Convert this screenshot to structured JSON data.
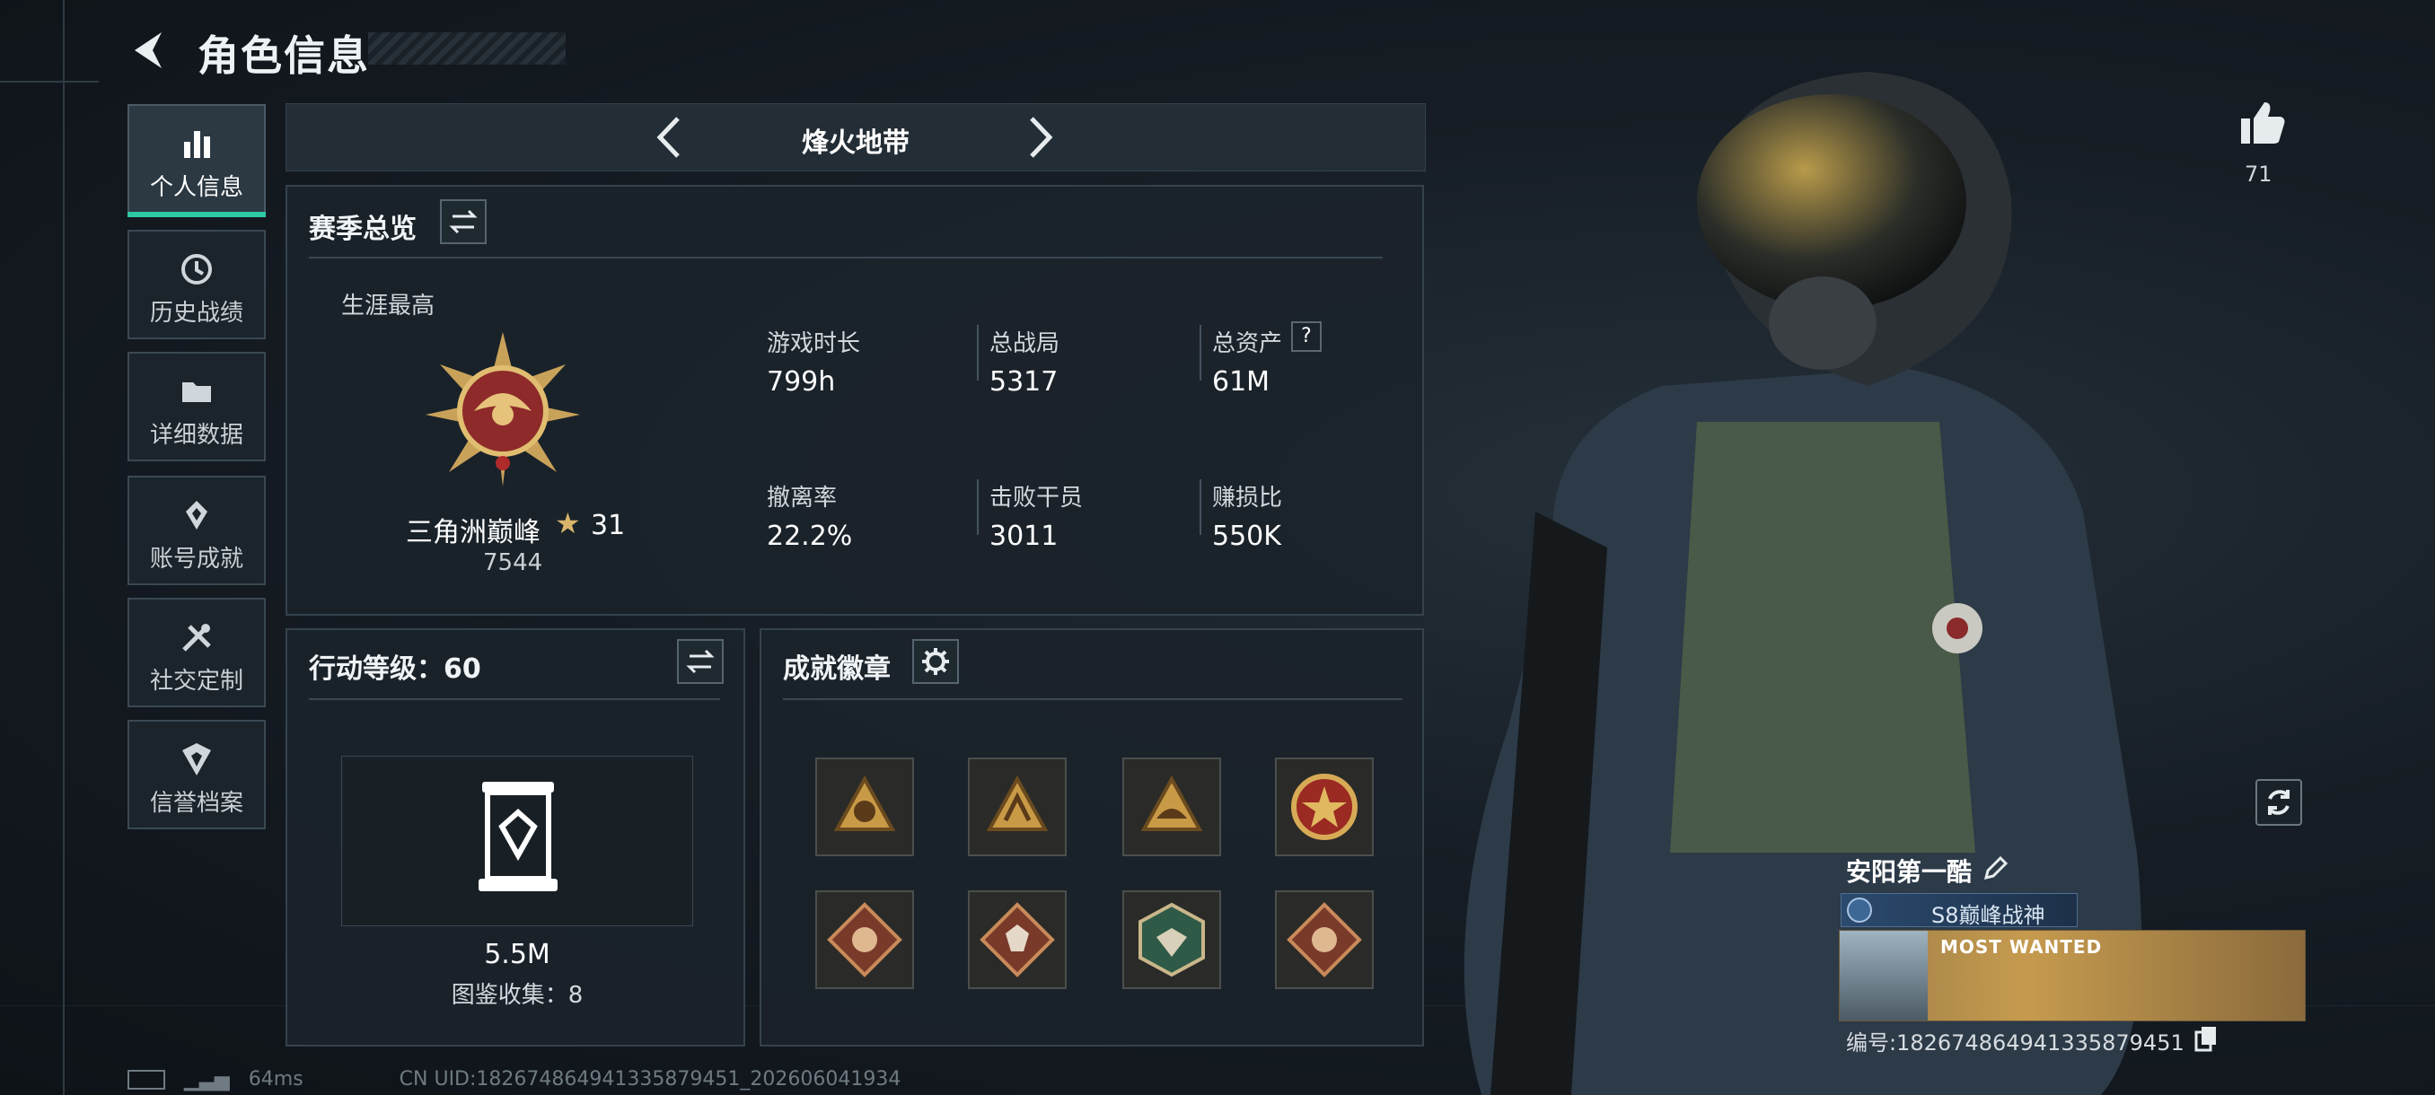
{
  "header": {
    "title": "角色信息"
  },
  "sidebar": {
    "items": [
      {
        "label": "个人信息",
        "icon": "bar-chart-icon",
        "active": true
      },
      {
        "label": "历史战绩",
        "icon": "history-icon"
      },
      {
        "label": "详细数据",
        "icon": "folder-icon"
      },
      {
        "label": "账号成就",
        "icon": "achievement-icon"
      },
      {
        "label": "社交定制",
        "icon": "tools-icon"
      },
      {
        "label": "信誉档案",
        "icon": "shield-icon"
      }
    ]
  },
  "mode": {
    "label": "烽火地带"
  },
  "season": {
    "title": "赛季总览",
    "career_label": "生涯最高",
    "rank_name": "三角洲巅峰",
    "rank_stars": "31",
    "rank_score": "7544",
    "stats": [
      {
        "label": "游戏时长",
        "value": "799h"
      },
      {
        "label": "总战局",
        "value": "5317"
      },
      {
        "label": "总资产",
        "value": "61M",
        "help": "?"
      },
      {
        "label": "撤离率",
        "value": "22.2%"
      },
      {
        "label": "击败干员",
        "value": "3011"
      },
      {
        "label": "赚损比",
        "value": "550K"
      }
    ]
  },
  "action": {
    "title": "行动等级：60",
    "value": "5.5M",
    "collection": "图鉴收集：8"
  },
  "badges": {
    "title": "成就徽章"
  },
  "player": {
    "likes": "71",
    "name": "安阳第一酷",
    "title_badge": "S8巅峰战神",
    "banner_text": "MOST WANTED",
    "id_line": "编号:182674864941335879451"
  },
  "footer": {
    "ping": "64ms",
    "uid": "CN UID:182674864941335879451_202606041934"
  },
  "colors": {
    "accent": "#2ec8a5",
    "panel": "#1b232a",
    "gold": "#c9a25a"
  }
}
